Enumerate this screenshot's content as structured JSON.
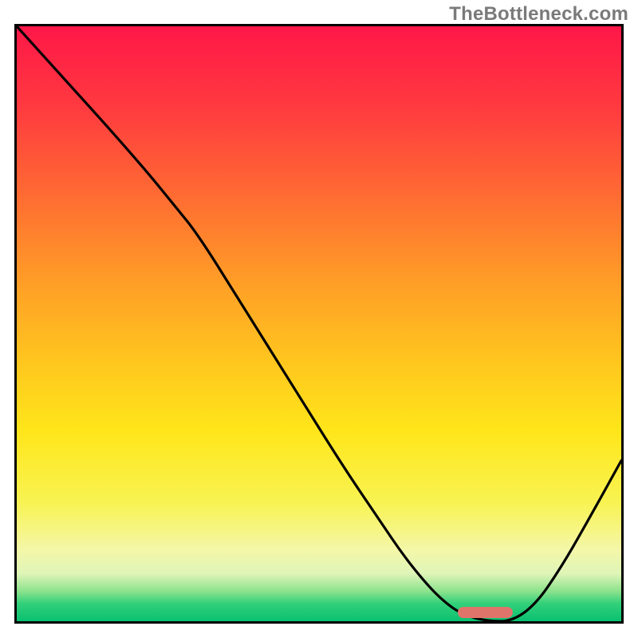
{
  "watermark": {
    "text": "TheBottleneck.com"
  },
  "chart_data": {
    "type": "line",
    "title": "",
    "xlabel": "",
    "ylabel": "",
    "xlim": [
      0,
      100
    ],
    "ylim": [
      0,
      100
    ],
    "grid": false,
    "legend": false,
    "annotations": [],
    "series": [
      {
        "name": "bottleneck-curve",
        "x": [
          0,
          8,
          16,
          22,
          26,
          30,
          38,
          46,
          54,
          60,
          64,
          68,
          71,
          74,
          78,
          82,
          86,
          90,
          94,
          100
        ],
        "y": [
          100,
          91,
          82,
          75,
          70,
          65,
          52,
          39,
          26,
          17,
          11,
          6,
          3,
          1,
          0,
          0,
          3,
          9,
          16,
          27
        ]
      }
    ],
    "optimum_marker": {
      "x_start": 73,
      "x_end": 82,
      "y": 1.5,
      "color": "#e0746b"
    },
    "background_gradient": {
      "stops": [
        {
          "pos": 0.0,
          "color": "#ff1748"
        },
        {
          "pos": 0.14,
          "color": "#ff3b3f"
        },
        {
          "pos": 0.28,
          "color": "#ff6a33"
        },
        {
          "pos": 0.44,
          "color": "#ffa126"
        },
        {
          "pos": 0.57,
          "color": "#ffc81e"
        },
        {
          "pos": 0.68,
          "color": "#ffe61a"
        },
        {
          "pos": 0.8,
          "color": "#f8f352"
        },
        {
          "pos": 0.88,
          "color": "#f4f7a8"
        },
        {
          "pos": 0.92,
          "color": "#dff5b8"
        },
        {
          "pos": 0.95,
          "color": "#8be28c"
        },
        {
          "pos": 0.97,
          "color": "#33d07a"
        },
        {
          "pos": 1.0,
          "color": "#09c171"
        }
      ]
    }
  }
}
